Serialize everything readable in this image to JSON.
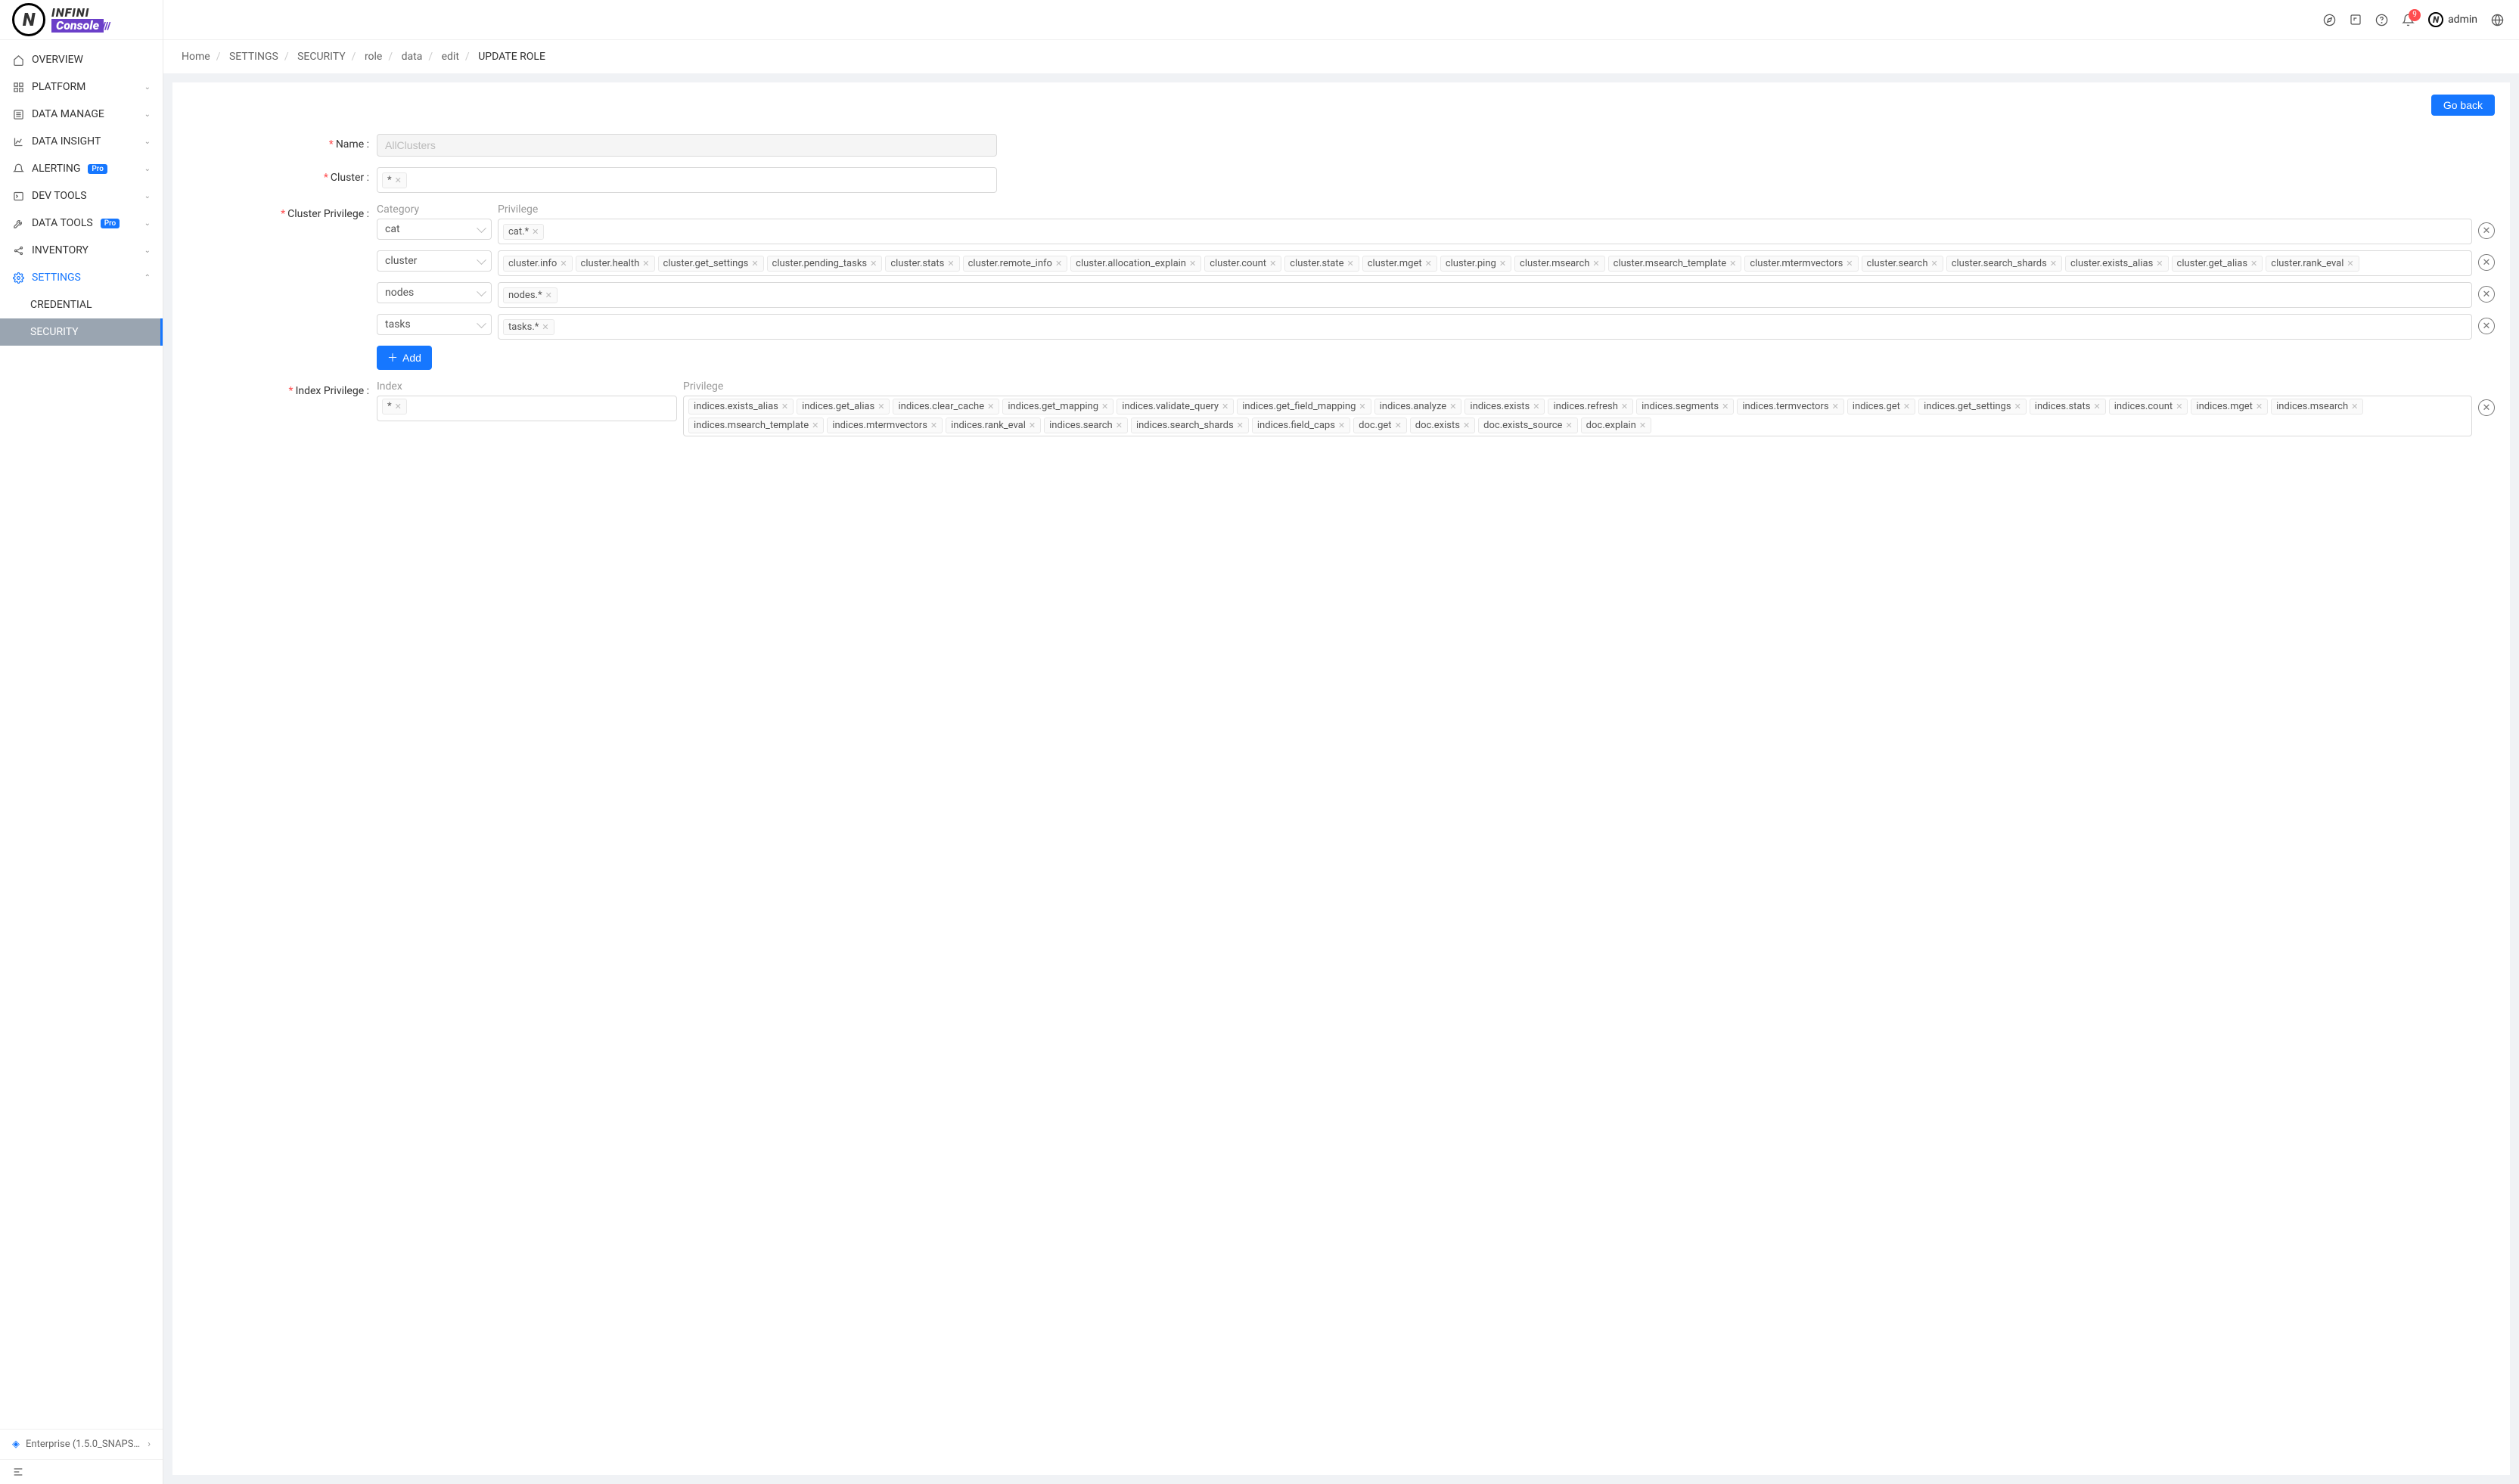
{
  "brand": {
    "top": "INFINI",
    "bottom": "Console"
  },
  "sidebar": {
    "items": [
      {
        "label": "OVERVIEW",
        "icon": "home"
      },
      {
        "label": "PLATFORM",
        "icon": "grid",
        "expandable": true
      },
      {
        "label": "DATA MANAGE",
        "icon": "list",
        "expandable": true
      },
      {
        "label": "DATA INSIGHT",
        "icon": "chart",
        "expandable": true
      },
      {
        "label": "ALERTING",
        "icon": "bell",
        "pro": true,
        "expandable": true
      },
      {
        "label": "DEV TOOLS",
        "icon": "terminal",
        "expandable": true
      },
      {
        "label": "DATA TOOLS",
        "icon": "wrench",
        "pro": true,
        "expandable": true
      },
      {
        "label": "INVENTORY",
        "icon": "share",
        "expandable": true
      },
      {
        "label": "SETTINGS",
        "icon": "gear",
        "expandable": true,
        "active": true
      }
    ],
    "subItems": [
      {
        "label": "CREDENTIAL"
      },
      {
        "label": "SECURITY",
        "selected": true
      }
    ],
    "footer": "Enterprise (1.5.0_SNAPS…",
    "proBadge": "Pro"
  },
  "topbar": {
    "notificationCount": "9",
    "username": "admin"
  },
  "breadcrumb": {
    "parts": [
      "Home",
      "SETTINGS",
      "SECURITY",
      "role",
      "data",
      "edit"
    ],
    "current": "UPDATE ROLE"
  },
  "buttons": {
    "goBack": "Go back",
    "add": "Add"
  },
  "form": {
    "nameLabel": "Name",
    "nameValue": "AllClusters",
    "clusterLabel": "Cluster",
    "clusterTags": [
      "*"
    ],
    "clusterPrivLabel": "Cluster Privilege",
    "categoryHeader": "Category",
    "privilegeHeader": "Privilege",
    "indexHeader": "Index",
    "indexPrivLabel": "Index Privilege",
    "clusterPrivRows": [
      {
        "category": "cat",
        "privileges": [
          "cat.*"
        ]
      },
      {
        "category": "cluster",
        "privileges": [
          "cluster.info",
          "cluster.health",
          "cluster.get_settings",
          "cluster.pending_tasks",
          "cluster.stats",
          "cluster.remote_info",
          "cluster.allocation_explain",
          "cluster.count",
          "cluster.state",
          "cluster.mget",
          "cluster.ping",
          "cluster.msearch",
          "cluster.msearch_template",
          "cluster.mtermvectors",
          "cluster.search",
          "cluster.search_shards",
          "cluster.exists_alias",
          "cluster.get_alias",
          "cluster.rank_eval"
        ]
      },
      {
        "category": "nodes",
        "privileges": [
          "nodes.*"
        ]
      },
      {
        "category": "tasks",
        "privileges": [
          "tasks.*"
        ]
      }
    ],
    "indexPrivileges": {
      "indices": [
        "*"
      ],
      "privileges": [
        "indices.exists_alias",
        "indices.get_alias",
        "indices.clear_cache",
        "indices.get_mapping",
        "indices.validate_query",
        "indices.get_field_mapping",
        "indices.analyze",
        "indices.exists",
        "indices.refresh",
        "indices.segments",
        "indices.termvectors",
        "indices.get",
        "indices.get_settings",
        "indices.stats",
        "indices.count",
        "indices.mget",
        "indices.msearch",
        "indices.msearch_template",
        "indices.mtermvectors",
        "indices.rank_eval",
        "indices.search",
        "indices.search_shards",
        "indices.field_caps",
        "doc.get",
        "doc.exists",
        "doc.exists_source",
        "doc.explain"
      ]
    }
  }
}
